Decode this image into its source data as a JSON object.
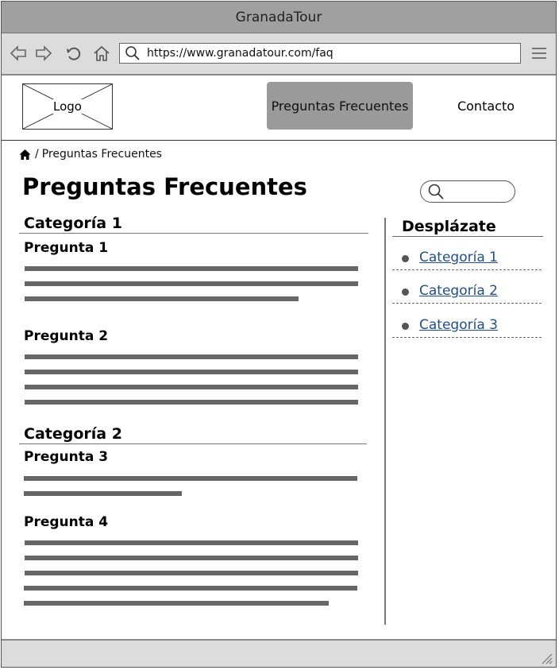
{
  "window": {
    "title": "GranadaTour"
  },
  "browser": {
    "url": "https://www.granadatour.com/faq",
    "icons": [
      "back-icon",
      "forward-icon",
      "reload-icon",
      "home-icon",
      "search-icon",
      "menu-icon"
    ]
  },
  "header": {
    "logo_label": "Logo",
    "nav": [
      {
        "label": "Preguntas Frecuentes",
        "active": true
      },
      {
        "label": "Contacto",
        "active": false
      }
    ]
  },
  "breadcrumb": {
    "separator": "/",
    "current": "Preguntas Frecuentes"
  },
  "page": {
    "title": "Preguntas Frecuentes"
  },
  "faq": {
    "categories": [
      {
        "title": "Categoría 1",
        "questions": [
          {
            "title": "Pregunta 1"
          },
          {
            "title": "Pregunta 2"
          }
        ]
      },
      {
        "title": "Categoría 2",
        "questions": [
          {
            "title": "Pregunta 3"
          },
          {
            "title": "Pregunta 4"
          }
        ]
      }
    ]
  },
  "sidebar": {
    "title": "Desplázate",
    "links": [
      {
        "label": "Categoría 1"
      },
      {
        "label": "Categoría 2"
      },
      {
        "label": "Categoría 3"
      }
    ]
  },
  "colors": {
    "active_nav": "#9a9a9a",
    "link": "#1d4f91",
    "chrome": "#dcdcdc",
    "titlebar": "#a0a0a0"
  }
}
